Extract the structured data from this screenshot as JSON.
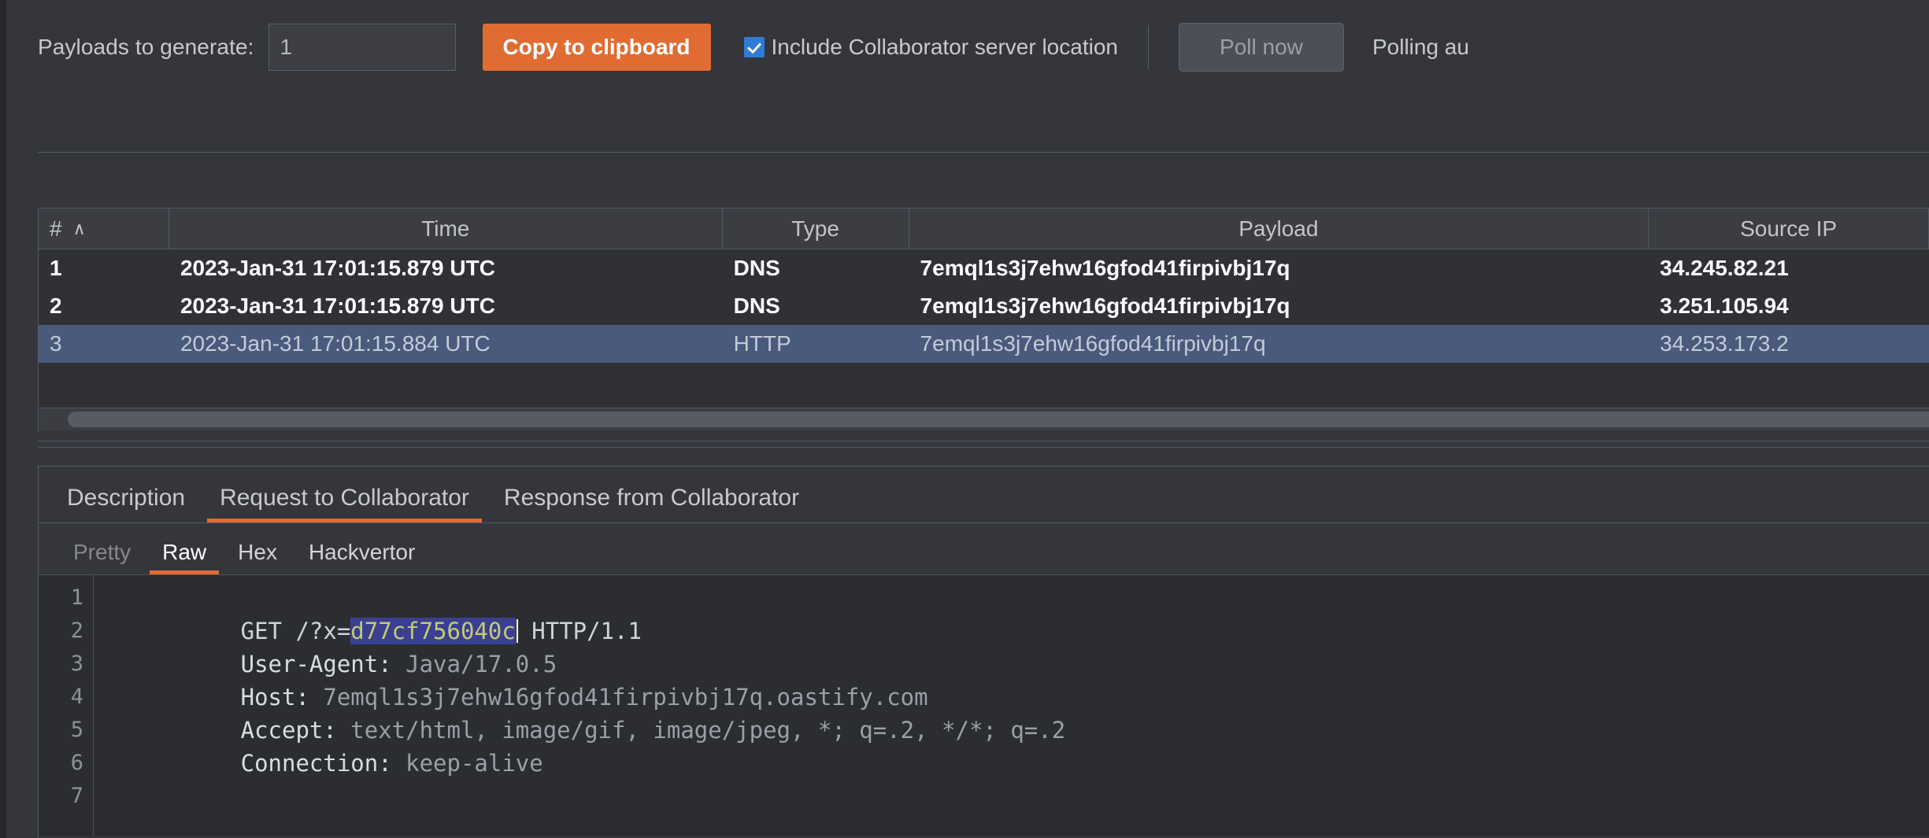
{
  "toolbar": {
    "payloads_label": "Payloads to generate:",
    "payloads_value": "1",
    "payloads_placeholder": "1",
    "copy_label": "Copy to clipboard",
    "include_location_label": "Include Collaborator server location",
    "include_location_checked": true,
    "poll_now_label": "Poll now",
    "polling_status": "Polling au",
    "accent_color": "#e06c33",
    "checkbox_color": "#2e7cd6"
  },
  "table": {
    "columns": [
      {
        "key": "num",
        "label": "#",
        "sort_indicator": "∧"
      },
      {
        "key": "time",
        "label": "Time"
      },
      {
        "key": "type",
        "label": "Type"
      },
      {
        "key": "payload",
        "label": "Payload"
      },
      {
        "key": "source_ip",
        "label": "Source IP"
      }
    ],
    "rows": [
      {
        "num": "1",
        "time": "2023-Jan-31 17:01:15.879 UTC",
        "type": "DNS",
        "payload": "7emql1s3j7ehw16gfod41firpivbj17q",
        "source_ip": "34.245.82.21",
        "selected": false
      },
      {
        "num": "2",
        "time": "2023-Jan-31 17:01:15.879 UTC",
        "type": "DNS",
        "payload": "7emql1s3j7ehw16gfod41firpivbj17q",
        "source_ip": "3.251.105.94",
        "selected": false
      },
      {
        "num": "3",
        "time": "2023-Jan-31 17:01:15.884 UTC",
        "type": "HTTP",
        "payload": "7emql1s3j7ehw16gfod41firpivbj17q",
        "source_ip": "34.253.173.2",
        "selected": true
      }
    ],
    "selection_color": "#4a5a7d"
  },
  "message_tabs": [
    {
      "label": "Description",
      "active": false
    },
    {
      "label": "Request to Collaborator",
      "active": true
    },
    {
      "label": "Response from Collaborator",
      "active": false
    }
  ],
  "view_tabs": [
    {
      "label": "Pretty",
      "active": false,
      "dim": true
    },
    {
      "label": "Raw",
      "active": true,
      "dim": false
    },
    {
      "label": "Hex",
      "active": false,
      "dim": false
    },
    {
      "label": "Hackvertor",
      "active": false,
      "dim": false
    }
  ],
  "editor": {
    "line_numbers": [
      "1",
      "2",
      "3",
      "4",
      "5",
      "6",
      "7"
    ],
    "lines": [
      {
        "segments": [
          {
            "text": "GET /?x=",
            "style": "plain"
          },
          {
            "text": "d77cf756040c",
            "style": "selected"
          },
          {
            "text": " HTTP/1.1",
            "style": "plain"
          }
        ]
      },
      {
        "segments": [
          {
            "text": "User-Agent:",
            "style": "header-name"
          },
          {
            "text": " Java/17.0.5",
            "style": "header-value"
          }
        ]
      },
      {
        "segments": [
          {
            "text": "Host:",
            "style": "header-name"
          },
          {
            "text": " 7emql1s3j7ehw16gfod41firpivbj17q.oastify.com",
            "style": "header-value"
          }
        ]
      },
      {
        "segments": [
          {
            "text": "Accept:",
            "style": "header-name"
          },
          {
            "text": " text/html, image/gif, image/jpeg, *; q=.2, */*; q=.2",
            "style": "header-value"
          }
        ]
      },
      {
        "segments": [
          {
            "text": "Connection:",
            "style": "header-name"
          },
          {
            "text": " keep-alive",
            "style": "header-value"
          }
        ]
      },
      {
        "segments": []
      },
      {
        "segments": []
      }
    ],
    "selection_bg": "#3b3f92",
    "selection_fg": "#c3cc6f"
  }
}
